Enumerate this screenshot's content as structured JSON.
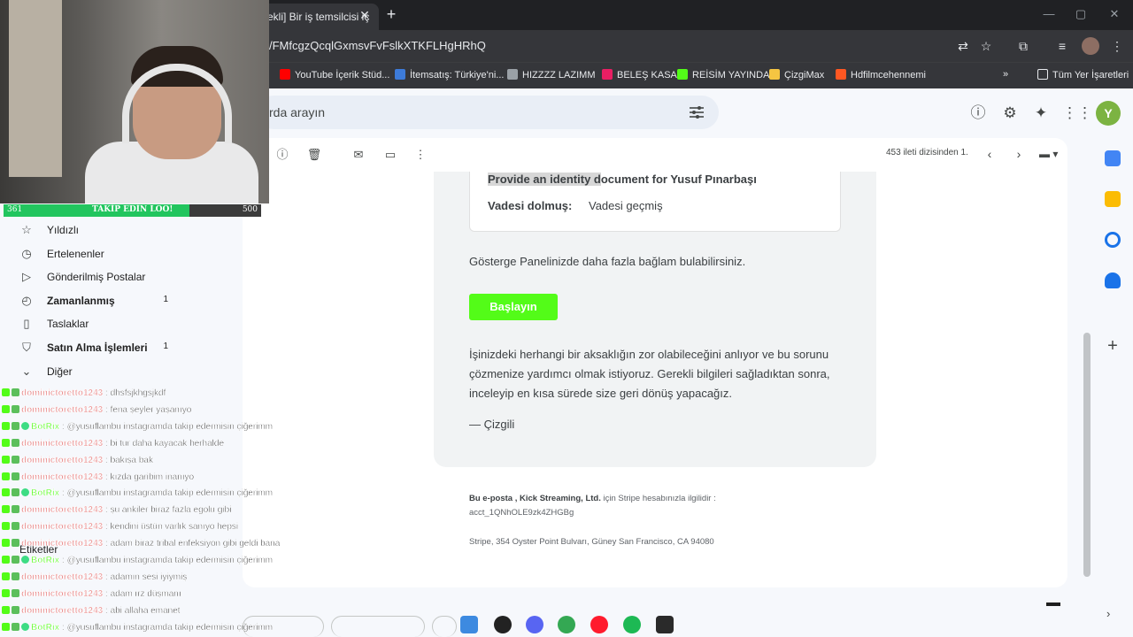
{
  "browser": {
    "tab_title": "ekli] Bir iş temsilcisi iç",
    "url": "/FMfcgzQcqlGxmsvFvFslkXTKFLHgHRhQ",
    "bookmarks": [
      {
        "label": "YouTube İçerik Stüd...",
        "color": "#ff0000"
      },
      {
        "label": "İtemsatış: Türkiye'ni...",
        "color": "#3d7bd9"
      },
      {
        "label": "HIZZZZ LAZIMM",
        "color": "#9aa0a6"
      },
      {
        "label": "BELEŞ KASA",
        "color": "#e91e63"
      },
      {
        "label": "REİSİM YAYINDA",
        "color": "#53fc18"
      },
      {
        "label": "ÇizgiMax",
        "color": "#f5c542"
      },
      {
        "label": "Hdfilmcehennemi",
        "color": "#ff5722"
      }
    ],
    "all_bookmarks": "Tüm Yer İşaretleri"
  },
  "gmail": {
    "search_placeholder": "rda arayın",
    "account_initial": "Y",
    "sidebar": [
      {
        "label": "Yıldızlı",
        "icon": "star-icon",
        "glyph": "☆",
        "count": "",
        "bold": false
      },
      {
        "label": "Ertelenenler",
        "icon": "clock-icon",
        "glyph": "◷",
        "count": "",
        "bold": false
      },
      {
        "label": "Gönderilmiş Postalar",
        "icon": "send-icon",
        "glyph": "▷",
        "count": "",
        "bold": false
      },
      {
        "label": "Zamanlanmış",
        "icon": "scheduled-icon",
        "glyph": "◴",
        "count": "1",
        "bold": true
      },
      {
        "label": "Taslaklar",
        "icon": "draft-icon",
        "glyph": "▯",
        "count": "",
        "bold": false
      },
      {
        "label": "Satın Alma İşlemleri",
        "icon": "purchase-icon",
        "glyph": "⛉",
        "count": "1",
        "bold": true
      },
      {
        "label": "Diğer",
        "icon": "chevron-down-icon",
        "glyph": "⌄",
        "count": "",
        "bold": false
      }
    ],
    "labels_title": "Etiketler",
    "pagination": "453 ileti dizisinden 1."
  },
  "email": {
    "task_title_highlight": "Provide an identity d",
    "task_title_rest": "ocument for Yusuf Pınarbaşı",
    "due_label": "Vadesi dolmuş:",
    "due_value": "Vadesi geçmiş",
    "context_text": "Gösterge Panelinizde daha fazla bağlam bulabilirsiniz.",
    "start_button": "Başlayın",
    "apology": "İşinizdeki herhangi bir aksaklığın zor olabileceğini anlıyor ve bu sorunu çözmenize yardımcı olmak istiyoruz. Gerekli bilgileri sağladıktan sonra, inceleyip en kısa sürede size geri dönüş yapacağız.",
    "signature": "— Çizgili",
    "footer_prefix": "Bu e-posta , Kick Streaming, Ltd.",
    "footer_suffix": " için Stripe hesabınızla ilgilidir :",
    "footer_account": "acct_1QNhOLE9zk4ZHGBg",
    "footer_address": "Stripe, 354 Oyster Point Bulvarı, Güney San Francisco, CA 94080"
  },
  "stream": {
    "follow_count": "361",
    "follow_text": "TAKİP EDİN LOO!",
    "follow_goal": "500",
    "follow_progress": 0.722,
    "chat": [
      {
        "user": "dominictoretto1243",
        "msg": ": dhsfsjkhgsjkdf",
        "user_color": "#e57373",
        "verified": false
      },
      {
        "user": "dominictoretto1243",
        "msg": ": fena şeyler yaşanıyo",
        "user_color": "#e57373",
        "verified": false
      },
      {
        "user": "BotRix",
        "msg": ": @yusuflambu instagramda takip edermisin çiğerimm",
        "user_color": "#53fc18",
        "verified": true
      },
      {
        "user": "dominictoretto1243",
        "msg": ": bi tur daha kayacak herhalde",
        "user_color": "#e57373",
        "verified": false
      },
      {
        "user": "dominictoretto1243",
        "msg": ": bakışa bak",
        "user_color": "#e57373",
        "verified": false
      },
      {
        "user": "dominictoretto1243",
        "msg": ": kızda garibim inanıyo",
        "user_color": "#e57373",
        "verified": false
      },
      {
        "user": "BotRix",
        "msg": ": @yusuflambu instagramda takip edermisin çiğerimm",
        "user_color": "#53fc18",
        "verified": true
      },
      {
        "user": "dominictoretto1243",
        "msg": ": şu ankiler biraz fazla egolu gibi",
        "user_color": "#e57373",
        "verified": false
      },
      {
        "user": "dominictoretto1243",
        "msg": ": kendini üstün varlık sanıyo hepsi",
        "user_color": "#e57373",
        "verified": false
      },
      {
        "user": "dominictoretto1243",
        "msg": ": adam biraz tribal enfeksiyon gibi geldi bana",
        "user_color": "#e57373",
        "verified": false
      },
      {
        "user": "BotRix",
        "msg": ": @yusuflambu instagramda takip edermisin çiğerimm",
        "user_color": "#53fc18",
        "verified": true
      },
      {
        "user": "dominictoretto1243",
        "msg": ": adamın sesi iyiymiş",
        "user_color": "#e57373",
        "verified": false
      },
      {
        "user": "dominictoretto1243",
        "msg": ": adam ırz düşmanı",
        "user_color": "#e57373",
        "verified": false
      },
      {
        "user": "dominictoretto1243",
        "msg": ": abi allaha emanet",
        "user_color": "#e57373",
        "verified": false
      },
      {
        "user": "BotRix",
        "msg": ": @yusuflambu instagramda takip edermisin çiğerimm",
        "user_color": "#53fc18",
        "verified": true
      }
    ]
  },
  "colors": {
    "kick_green": "#53fc18",
    "chrome_dark": "#35363a",
    "gmail_bg": "#f6f8fc"
  }
}
